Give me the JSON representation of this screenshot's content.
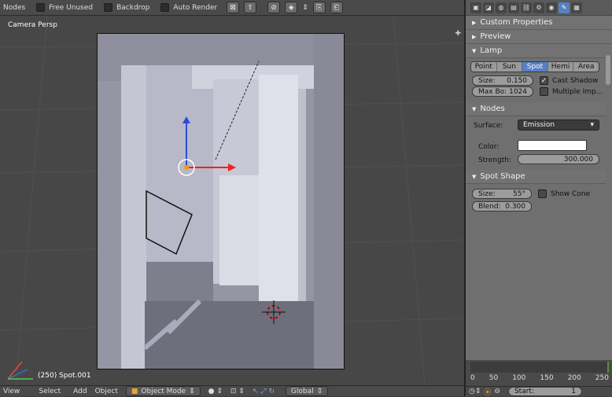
{
  "topbar": {
    "nodes_label": "Nodes",
    "free_unused": "Free Unused",
    "backdrop": "Backdrop",
    "auto_render": "Auto Render"
  },
  "viewport": {
    "label": "Camera Persp",
    "status": "(250) Spot.001"
  },
  "bottombar": {
    "view": "View",
    "select": "Select",
    "add": "Add",
    "object": "Object",
    "mode": "Object Mode",
    "orientation": "Global"
  },
  "panel": {
    "sections": {
      "custom_properties": "Custom Properties",
      "preview": "Preview",
      "lamp": "Lamp",
      "nodes": "Nodes",
      "spot_shape": "Spot Shape"
    },
    "lamp_types": [
      "Point",
      "Sun",
      "Spot",
      "Hemi",
      "Area"
    ],
    "lamp_type_active": "Spot",
    "size": {
      "label": "Size:",
      "value": "0.150"
    },
    "max_bounces": {
      "label": "Max Bo:",
      "value": "1024"
    },
    "cast_shadow": "Cast Shadow",
    "multiple_importance": "Multiple Imp...",
    "surface": {
      "label": "Surface:",
      "value": "Emission"
    },
    "color": {
      "label": "Color:",
      "value": "#ffffff"
    },
    "strength": {
      "label": "Strength:",
      "value": "300.000"
    },
    "spot_size": {
      "label": "Size:",
      "value": "55°"
    },
    "show_cone": "Show Cone",
    "blend": {
      "label": "Blend:",
      "value": "0.300"
    }
  },
  "timeline": {
    "ticks": [
      "0",
      "50",
      "100",
      "150",
      "200",
      "250"
    ],
    "start_label": "Start:",
    "start_value": "1"
  }
}
